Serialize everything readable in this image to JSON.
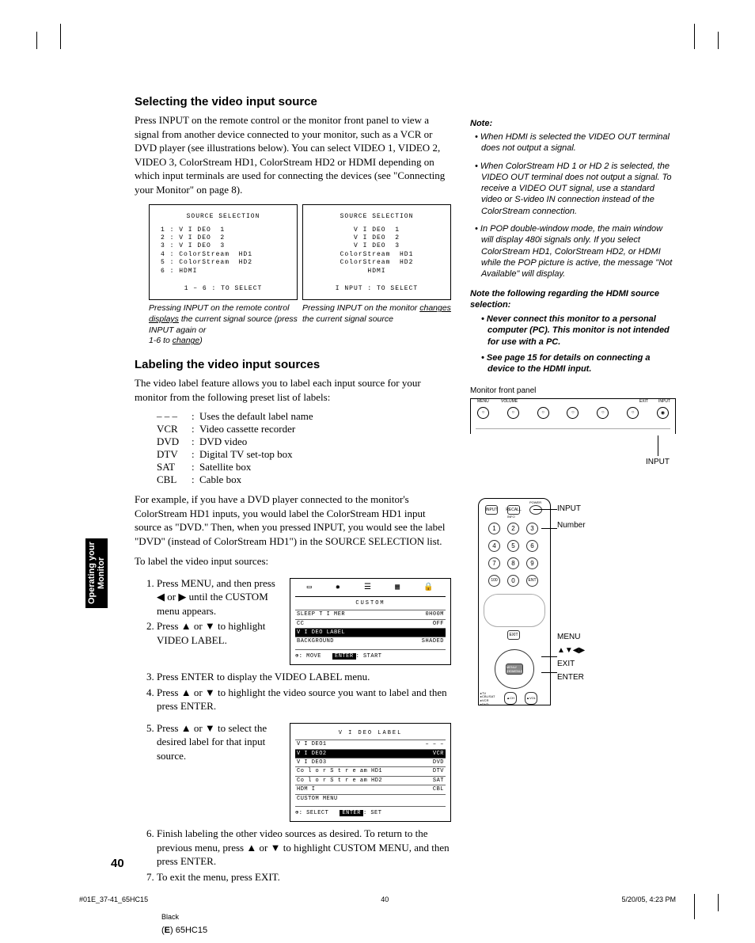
{
  "h1": "Selecting the video input source",
  "p1": "Press INPUT on the remote control or the monitor front panel to view a signal from another device connected to your monitor, such as a VCR or DVD player (see illustrations below). You can select VIDEO 1, VIDEO 2, VIDEO 3, ColorStream HD1, ColorStream HD2 or HDMI depending on which input terminals are used for connecting the devices (see \"Connecting your Monitor\" on page 8).",
  "osd": {
    "left": {
      "title": "SOURCE  SELECTION",
      "lines": [
        "1 : V I DEO  1",
        "2 : V I DEO  2",
        "3 : V I DEO  3",
        "4 : ColorStream  HD1",
        "5 : ColorStream  HD2",
        "6 : HDMI"
      ],
      "foot": "1 – 6 : TO  SELECT"
    },
    "right": {
      "title": "SOURCE  SELECTION",
      "lines": [
        "V I DEO  1",
        "V I DEO  2",
        "V I DEO  3",
        "ColorStream  HD1",
        "ColorStream  HD2",
        "HDMI"
      ],
      "foot": "I NPUT : TO  SELECT"
    }
  },
  "cap_left_1": "Pressing INPUT on the remote control ",
  "cap_left_u1": "displays",
  "cap_left_2": " the current signal source (press INPUT again or",
  "cap_left_3": "1-6 to ",
  "cap_left_u2": "change",
  "cap_left_4": ")",
  "cap_right_1": "Pressing INPUT on the monitor ",
  "cap_right_u1": "changes",
  "cap_right_2": " the current signal source",
  "h2": "Labeling the video input sources",
  "p2": "The video label feature allows you to label each input source for your monitor from the following preset list of labels:",
  "labels": [
    {
      "abbr": "– – –",
      "desc": "Uses the default label name"
    },
    {
      "abbr": "VCR",
      "desc": "Video cassette recorder"
    },
    {
      "abbr": "DVD",
      "desc": "DVD video"
    },
    {
      "abbr": "DTV",
      "desc": "Digital TV set-top box"
    },
    {
      "abbr": "SAT",
      "desc": "Satellite box"
    },
    {
      "abbr": "CBL",
      "desc": "Cable box"
    }
  ],
  "p3": "For example, if you have a DVD player connected to the monitor's ColorStream HD1 inputs, you would label the ColorStream HD1 input source as \"DVD.\" Then, when you pressed INPUT, you would see the label \"DVD\" (instead of ColorStream HD1\") in the SOURCE SELECTION list.",
  "p4": "To label the video input sources:",
  "step1a": "Press MENU, and then press ",
  "step1b": " or ",
  "step1c": " until the CUSTOM menu appears.",
  "step2a": "Press ",
  "step2b": " or ",
  "step2c": " to highlight VIDEO LABEL.",
  "step3": "Press ENTER to display the VIDEO LABEL menu.",
  "step4a": "Press ",
  "step4b": " or ",
  "step4c": " to highlight the video source you want to label and then press ENTER.",
  "step5a": "Press ",
  "step5b": " or ",
  "step5c": " to select the desired label for that input source.",
  "step6a": "Finish labeling the other video sources as desired. To return to the previous menu, press ",
  "step6b": " or ",
  "step6c": " to highlight CUSTOM MENU, and then press ENTER.",
  "step7": "To exit the menu, press EXIT.",
  "custom_menu": {
    "title": "CUSTOM",
    "rows": [
      {
        "l": "SLEEP  T I MER",
        "r": "0H00M"
      },
      {
        "l": "CC",
        "r": "OFF"
      },
      {
        "l": "V I DEO  LABEL",
        "r": "",
        "hl": true
      },
      {
        "l": "BACKGROUND",
        "r": "SHADED"
      }
    ],
    "foot_move": ": MOVE",
    "foot_btn": "ENTER",
    "foot_start": ": START"
  },
  "video_label_menu": {
    "title": "V I DEO  LABEL",
    "rows": [
      {
        "l": "V I DEO1",
        "r": "– – –"
      },
      {
        "l": "V I DEO2",
        "r": "VCR",
        "hl": true
      },
      {
        "l": "V I DEO3",
        "r": "DVD"
      },
      {
        "l": "Co l o r S t r e am  HD1",
        "r": "DTV"
      },
      {
        "l": "Co l o r S t r e am  HD2",
        "r": "SAT"
      },
      {
        "l": "HDM I",
        "r": "CBL"
      },
      {
        "l": "CUSTOM  MENU",
        "r": ""
      }
    ],
    "foot_sel": ": SELECT",
    "foot_btn": "ENTER",
    "foot_set": ": SET"
  },
  "note_head": "Note:",
  "note1": "When HDMI is selected the VIDEO OUT terminal does not output a signal.",
  "note2": "When ColorStream HD 1 or HD 2 is selected, the VIDEO OUT terminal does not output a signal. To receive a VIDEO OUT signal, use a standard video or S-video IN connection instead of the ColorStream connection.",
  "note3": "In POP double-window mode, the main window will display 480i signals only. If you select ColorStream HD1, ColorStream HD2, or HDMI while the POP picture is active, the message \"Not Available\" will display.",
  "note_strong_head": "Note the following regarding the HDMI source selection:",
  "ns1": "Never connect this monitor to a personal computer (PC). This monitor is not intended for use with a PC.",
  "ns2": "See page 15 for details on connecting a device to the HDMI input.",
  "panel_label": "Monitor front panel",
  "fp": {
    "menu": "MENU",
    "volume": "VOLUME",
    "exit": "EXIT",
    "input": "INPUT"
  },
  "input_callout": "INPUT",
  "remote_callouts": {
    "input": "INPUT",
    "number": "Number",
    "menu": "MENU",
    "arrows": "▲▼◀▶",
    "exit": "EXIT",
    "enter": "ENTER"
  },
  "remote_labels": {
    "input": "INPUT",
    "recall": "RECALL",
    "power": "POWER",
    "info": "INFO",
    "menu": "MENU/\n(HDMENU)",
    "tv": "TV",
    "cblsat": "CBL/SAT",
    "vcr": "VCR",
    "dvd": "DVD",
    "ch": "CH",
    "vol": "VOL"
  },
  "side_tab": "Operating your Monitor",
  "page_number": "40",
  "foot_file": "#01E_37-41_65HC15",
  "foot_page": "40",
  "foot_date": "5/20/05, 4:23 PM",
  "foot_black": "Black",
  "foot_model_pre": "(",
  "foot_model_e": "E",
  "foot_model_post": ") 65HC15"
}
